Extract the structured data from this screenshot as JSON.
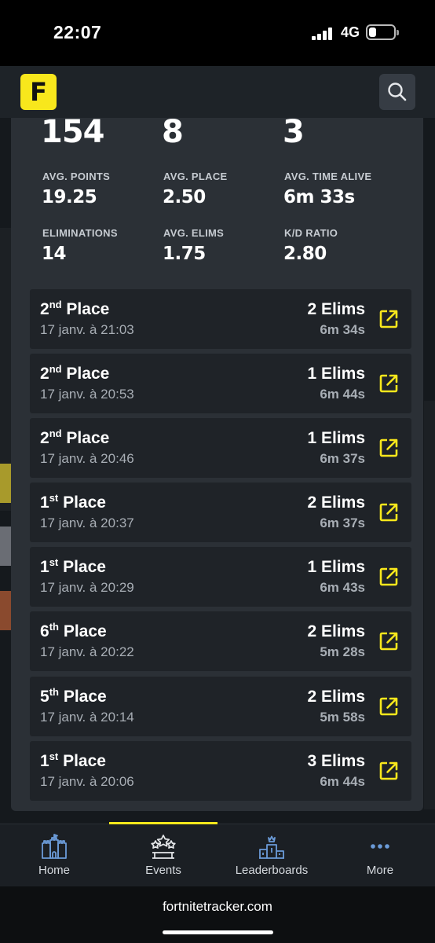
{
  "status": {
    "time": "22:07",
    "network": "4G",
    "battery_level": 0.3
  },
  "header": {
    "logo_text": "F"
  },
  "summary": {
    "big_values": [
      "154",
      "8",
      "3"
    ],
    "stats": [
      {
        "label": "AVG. POINTS",
        "value": "19.25"
      },
      {
        "label": "AVG. PLACE",
        "value": "2.50"
      },
      {
        "label": "AVG. TIME ALIVE",
        "value": "6m 33s"
      },
      {
        "label": "ELIMINATIONS",
        "value": "14"
      },
      {
        "label": "AVG. ELIMS",
        "value": "1.75"
      },
      {
        "label": "K/D RATIO",
        "value": "2.80"
      }
    ]
  },
  "matches": [
    {
      "place": "2",
      "suffix": "nd",
      "place_word": "Place",
      "date": "17 janv. à 21:03",
      "elims": "2 Elims",
      "time": "6m 34s"
    },
    {
      "place": "2",
      "suffix": "nd",
      "place_word": "Place",
      "date": "17 janv. à 20:53",
      "elims": "1 Elims",
      "time": "6m 44s"
    },
    {
      "place": "2",
      "suffix": "nd",
      "place_word": "Place",
      "date": "17 janv. à 20:46",
      "elims": "1 Elims",
      "time": "6m 37s"
    },
    {
      "place": "1",
      "suffix": "st",
      "place_word": "Place",
      "date": "17 janv. à 20:37",
      "elims": "2 Elims",
      "time": "6m 37s"
    },
    {
      "place": "1",
      "suffix": "st",
      "place_word": "Place",
      "date": "17 janv. à 20:29",
      "elims": "1 Elims",
      "time": "6m 43s"
    },
    {
      "place": "6",
      "suffix": "th",
      "place_word": "Place",
      "date": "17 janv. à 20:22",
      "elims": "2 Elims",
      "time": "5m 28s"
    },
    {
      "place": "5",
      "suffix": "th",
      "place_word": "Place",
      "date": "17 janv. à 20:14",
      "elims": "2 Elims",
      "time": "5m 58s"
    },
    {
      "place": "1",
      "suffix": "st",
      "place_word": "Place",
      "date": "17 janv. à 20:06",
      "elims": "3 Elims",
      "time": "6m 44s"
    }
  ],
  "nav": {
    "items": [
      {
        "label": "Home",
        "icon": "castle-icon"
      },
      {
        "label": "Events",
        "icon": "stars-podium-icon"
      },
      {
        "label": "Leaderboards",
        "icon": "podium-icon"
      },
      {
        "label": "More",
        "icon": "dots-icon"
      }
    ],
    "active_index": 1
  },
  "browser": {
    "url": "fortnitetracker.com"
  },
  "colors": {
    "accent": "#f8e71c",
    "panel": "#2b3036",
    "row": "#1f2328",
    "nav_icon": "#6b9bd8"
  }
}
